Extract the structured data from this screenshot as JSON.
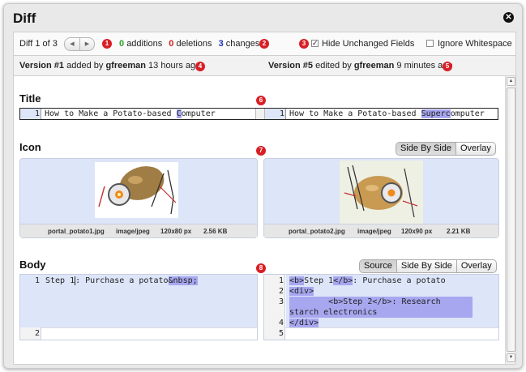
{
  "dialog": {
    "title": "Diff"
  },
  "toolbar": {
    "diff_label": "Diff 1 of 3",
    "additions_count": "0",
    "additions_label": "additions",
    "deletions_count": "0",
    "deletions_label": "deletions",
    "changes_count": "3",
    "changes_label": "changes",
    "hide_unchanged_label": "Hide Unchanged Fields",
    "hide_unchanged_checked": true,
    "ignore_whitespace_label": "Ignore Whitespace",
    "ignore_whitespace_checked": false
  },
  "meta": {
    "left_version": "Version #1",
    "left_action": "added by",
    "left_user": "gfreeman",
    "left_time": "13 hours ago",
    "right_version": "Version #5",
    "right_action": "edited by",
    "right_user": "gfreeman",
    "right_time": "9 minutes ago"
  },
  "badges": [
    "1",
    "2",
    "3",
    "4",
    "5",
    "6",
    "7",
    "8"
  ],
  "title_section": {
    "heading": "Title",
    "left_line_no": "1",
    "left_text_a": "How to Make a Potato-based ",
    "left_text_hl": "C",
    "left_text_b": "omputer",
    "right_line_no": "1",
    "right_text_a": "How to Make a Potato-based ",
    "right_text_hl": "Superc",
    "right_text_b": "omputer"
  },
  "icon_section": {
    "heading": "Icon",
    "view_modes": [
      "Side By Side",
      "Overlay"
    ],
    "left_image": {
      "name": "portal_potato1.jpg",
      "type": "image/jpeg",
      "dims": "120x80 px",
      "size": "2.56 KB"
    },
    "right_image": {
      "name": "portal_potato2.jpg",
      "type": "image/jpeg",
      "dims": "120x90 px",
      "size": "2.21 KB"
    }
  },
  "body_section": {
    "heading": "Body",
    "view_modes": [
      "Source",
      "Side By Side",
      "Overlay"
    ],
    "left_lines": [
      {
        "no": "1",
        "a": "Step 1",
        "b": ": Purchase a potato",
        "hl": "&nbsp;"
      },
      {
        "no": "2",
        "text": ""
      }
    ],
    "right_lines": [
      {
        "no": "1",
        "hl1": "<b>",
        "a": "Step 1",
        "hl2": "</b>",
        "b": ": Purchase a potato"
      },
      {
        "no": "2",
        "hl": "<div>"
      },
      {
        "no": "3",
        "hl": "        <b>Step 2</b>: Research starch electronics"
      },
      {
        "no": "4",
        "hl": "</div>"
      },
      {
        "no": "5",
        "text": ""
      }
    ]
  },
  "colors": {
    "added_highlight": "#a7a7f0",
    "change_block": "#dde5f9",
    "badge": "#d81f26"
  }
}
